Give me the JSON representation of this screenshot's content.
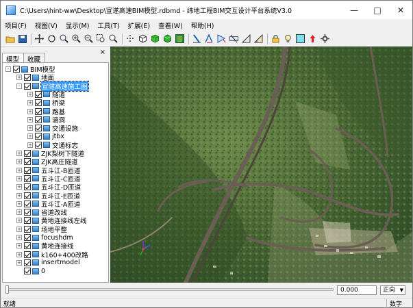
{
  "window": {
    "title": "C:\\Users\\hint-ww\\Desktop\\宣遂高速BIM模型.rdbmd - 纬地工程BIM交互设计平台系统V3.0",
    "controls": [
      "minimize-icon",
      "maximize-icon",
      "close-icon"
    ]
  },
  "menu": [
    "项目(F)",
    "视图(V)",
    "显示(M)",
    "工具(T)",
    "扩展(E)",
    "查看(W)",
    "帮助(H)"
  ],
  "toolbar": {
    "icons": [
      "open-folder-icon",
      "save-icon",
      "pan-icon",
      "rotate-icon",
      "zoom-icon",
      "zoom-in-icon",
      "zoom-out-icon",
      "zoom-window-icon",
      "zoom-extents-icon",
      "point-cloud-icon",
      "cube-outline-icon",
      "green-cube-icon",
      "green-blocks-icon",
      "layer-stack-icon",
      "measure-distance-icon",
      "measure-angle-icon",
      "measure-area-icon",
      "section-icon",
      "slope-icon",
      "slope-alt-icon",
      "lock-icon",
      "bulb-icon",
      "color-fill-icon",
      "red-arrow-icon",
      "settings-icon"
    ]
  },
  "panel": {
    "close": "×",
    "tabs": [
      "模型",
      "收藏"
    ]
  },
  "tree": [
    {
      "label": "BIM模型",
      "level": 0,
      "expander": "-",
      "selected": false
    },
    {
      "label": "地面",
      "level": 1,
      "expander": "+",
      "selected": false
    },
    {
      "label": "宣隧高速施工图",
      "level": 1,
      "expander": "-",
      "selected": true
    },
    {
      "label": "隧道",
      "level": 2,
      "expander": "+",
      "selected": false
    },
    {
      "label": "桥梁",
      "level": 2,
      "expander": "+",
      "selected": false
    },
    {
      "label": "路基",
      "level": 2,
      "expander": "+",
      "selected": false
    },
    {
      "label": "涵洞",
      "level": 2,
      "expander": "+",
      "selected": false
    },
    {
      "label": "交通设施",
      "level": 2,
      "expander": "+",
      "selected": false
    },
    {
      "label": "jtbx",
      "level": 2,
      "expander": "+",
      "selected": false
    },
    {
      "label": "交通标志",
      "level": 2,
      "expander": "+",
      "selected": false
    },
    {
      "label": "ZJK梨树下隧道",
      "level": 1,
      "expander": "+",
      "selected": false
    },
    {
      "label": "ZJK高庄隧道",
      "level": 1,
      "expander": "+",
      "selected": false
    },
    {
      "label": "五斗江-B匝道",
      "level": 1,
      "expander": "+",
      "selected": false
    },
    {
      "label": "五斗江-C匝道",
      "level": 1,
      "expander": "+",
      "selected": false
    },
    {
      "label": "五斗江-D匝道",
      "level": 1,
      "expander": "+",
      "selected": false
    },
    {
      "label": "五斗江-E匝道",
      "level": 1,
      "expander": "+",
      "selected": false
    },
    {
      "label": "五斗江-A匝道",
      "level": 1,
      "expander": "+",
      "selected": false
    },
    {
      "label": "省道改线",
      "level": 1,
      "expander": "+",
      "selected": false
    },
    {
      "label": "黄地连接线左线",
      "level": 1,
      "expander": "+",
      "selected": false
    },
    {
      "label": "场地平整",
      "level": 1,
      "expander": "+",
      "selected": false
    },
    {
      "label": "focushdm",
      "level": 1,
      "expander": "+",
      "selected": false
    },
    {
      "label": "黄地连接线",
      "level": 1,
      "expander": "+",
      "selected": false
    },
    {
      "label": "k160+400改路",
      "level": 1,
      "expander": "+",
      "selected": false
    },
    {
      "label": "insertmodel",
      "level": 1,
      "expander": "+",
      "selected": false
    },
    {
      "label": "0",
      "level": 1,
      "expander": "",
      "selected": false
    }
  ],
  "bottom": {
    "slider_position": 0,
    "value": "0.000",
    "direction": "正向"
  },
  "status": {
    "left": "就绪",
    "right": "数字"
  },
  "colors": {
    "selection": "#3399ff",
    "terrain": "#4d6a3a",
    "road": "#6b5e55"
  }
}
